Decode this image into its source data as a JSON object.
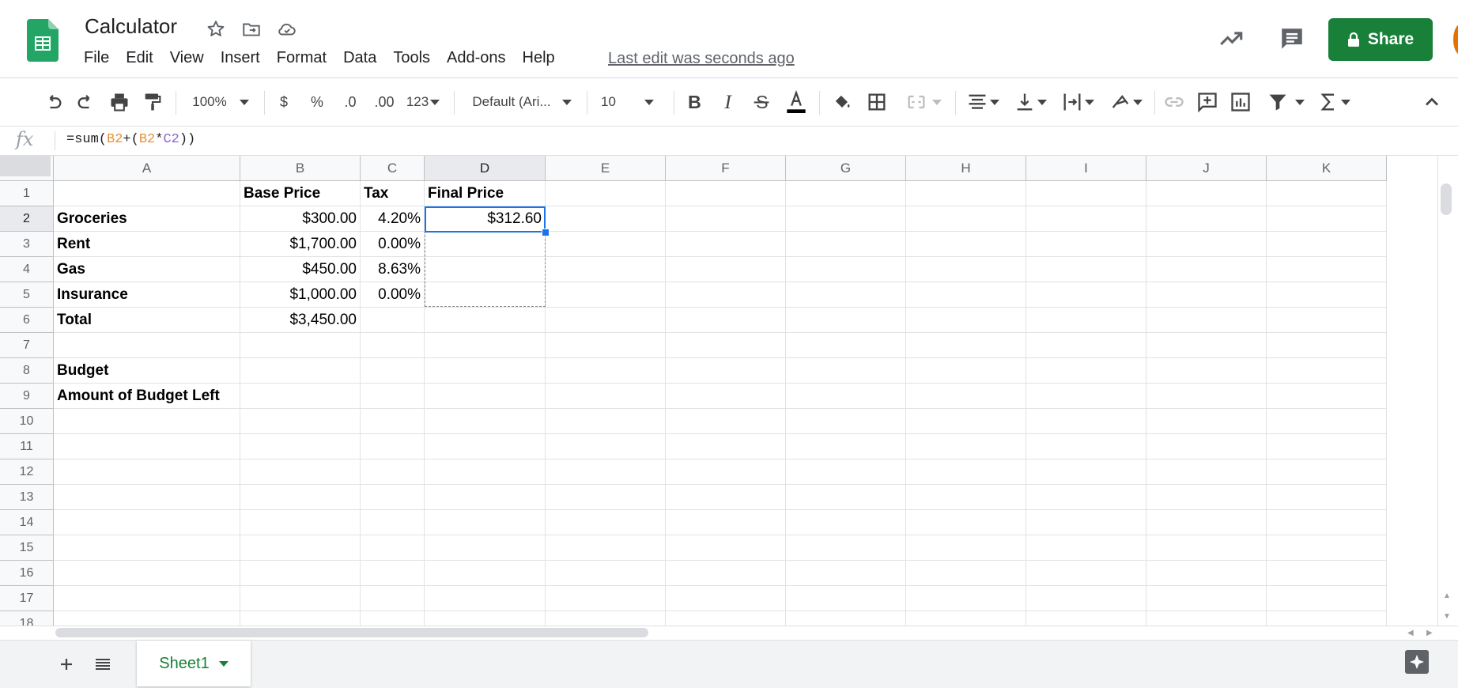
{
  "header": {
    "title": "Calculator",
    "menu": [
      "File",
      "Edit",
      "View",
      "Insert",
      "Format",
      "Data",
      "Tools",
      "Add-ons",
      "Help"
    ],
    "last_edit": "Last edit was seconds ago",
    "share_label": "Share"
  },
  "toolbar": {
    "zoom": "100%",
    "currency": "$",
    "percent": "%",
    "dec_decrease": ".0",
    "dec_increase": ".00",
    "more_formats": "123",
    "font": "Default (Ari...",
    "font_size": "10"
  },
  "formula_bar": {
    "fx": "fx",
    "parts": [
      "=sum(",
      "B2",
      "+(",
      "B2",
      "*",
      "C2",
      "))"
    ]
  },
  "grid": {
    "columns": [
      "A",
      "B",
      "C",
      "D",
      "E",
      "F",
      "G",
      "H",
      "I",
      "J",
      "K"
    ],
    "selected_column": "D",
    "rows": [
      "1",
      "2",
      "3",
      "4",
      "5",
      "6",
      "7",
      "8",
      "9",
      "10",
      "11",
      "12",
      "13",
      "14",
      "15",
      "16",
      "17",
      "18"
    ],
    "selected_row": "2",
    "selected_cell": "D2",
    "cells": {
      "B1": "Base Price",
      "C1": "Tax",
      "D1": "Final Price",
      "A2": "Groceries",
      "B2": "$300.00",
      "C2": "4.20%",
      "D2": "$312.60",
      "A3": "Rent",
      "B3": "$1,700.00",
      "C3": "0.00%",
      "A4": "Gas",
      "B4": "$450.00",
      "C4": "8.63%",
      "A5": "Insurance",
      "B5": "$1,000.00",
      "C5": "0.00%",
      "A6": "Total",
      "B6": "$3,450.00",
      "A8": "Budget",
      "A9": "Amount of Budget Left"
    }
  },
  "sheets": {
    "tabs": [
      "Sheet1"
    ],
    "active": "Sheet1"
  },
  "colors": {
    "brand_green": "#188038",
    "selection_blue": "#1a73e8",
    "formula_ref_orange": "#e69138",
    "formula_ref_purple": "#8e63ce"
  }
}
